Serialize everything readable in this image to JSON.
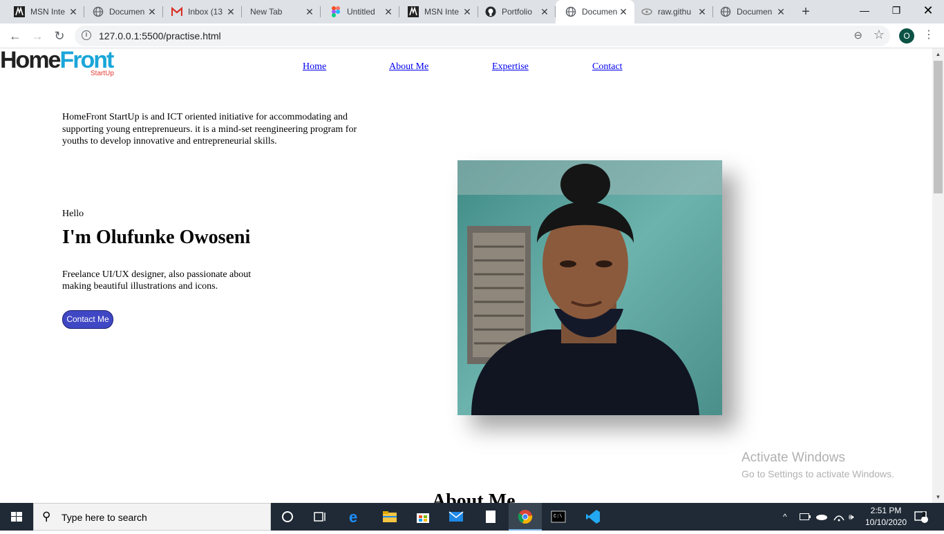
{
  "browser": {
    "tabs": [
      {
        "title": "MSN Inte",
        "icon": "msn-icon"
      },
      {
        "title": "Documen",
        "icon": "globe-icon"
      },
      {
        "title": "Inbox (13",
        "icon": "gmail-icon"
      },
      {
        "title": "New Tab",
        "icon": "none"
      },
      {
        "title": "Untitled",
        "icon": "figma-icon"
      },
      {
        "title": "MSN Inte",
        "icon": "msn-icon"
      },
      {
        "title": "Portfolio",
        "icon": "github-icon"
      },
      {
        "title": "Documen",
        "icon": "globe-icon",
        "active": true
      },
      {
        "title": "raw.githu",
        "icon": "github-raw-icon"
      },
      {
        "title": "Documen",
        "icon": "globe-icon"
      }
    ],
    "url": "127.0.0.1:5500/practise.html",
    "profile_initial": "O"
  },
  "page": {
    "logo": {
      "home": "Home",
      "front": "Front",
      "sub": "StartUp"
    },
    "nav": [
      "Home",
      "About Me",
      "Expertise",
      "Contact"
    ],
    "intro": "HomeFront StartUp is and ICT oriented initiative for accommodating and supporting young entreprenueurs. it is a mind-set reengineering program for youths to develop innovative and entrepreneurial skills.",
    "hello": "Hello",
    "name": "I'm Olufunke Owoseni",
    "bio": "Freelance UI/UX designer, also passionate about making beautiful illustrations and icons.",
    "contact_button": "Contact Me",
    "next_heading": "About Me"
  },
  "watermark": {
    "line1": "Activate Windows",
    "line2": "Go to Settings to activate Windows."
  },
  "taskbar": {
    "search_placeholder": "Type here to search",
    "time": "2:51 PM",
    "date": "10/10/2020",
    "notifications": "2"
  },
  "colors": {
    "accent_button": "#4047c4",
    "logo_blue": "#1aa6d9",
    "logo_red": "#e53935",
    "taskbar": "#1f2a36"
  }
}
